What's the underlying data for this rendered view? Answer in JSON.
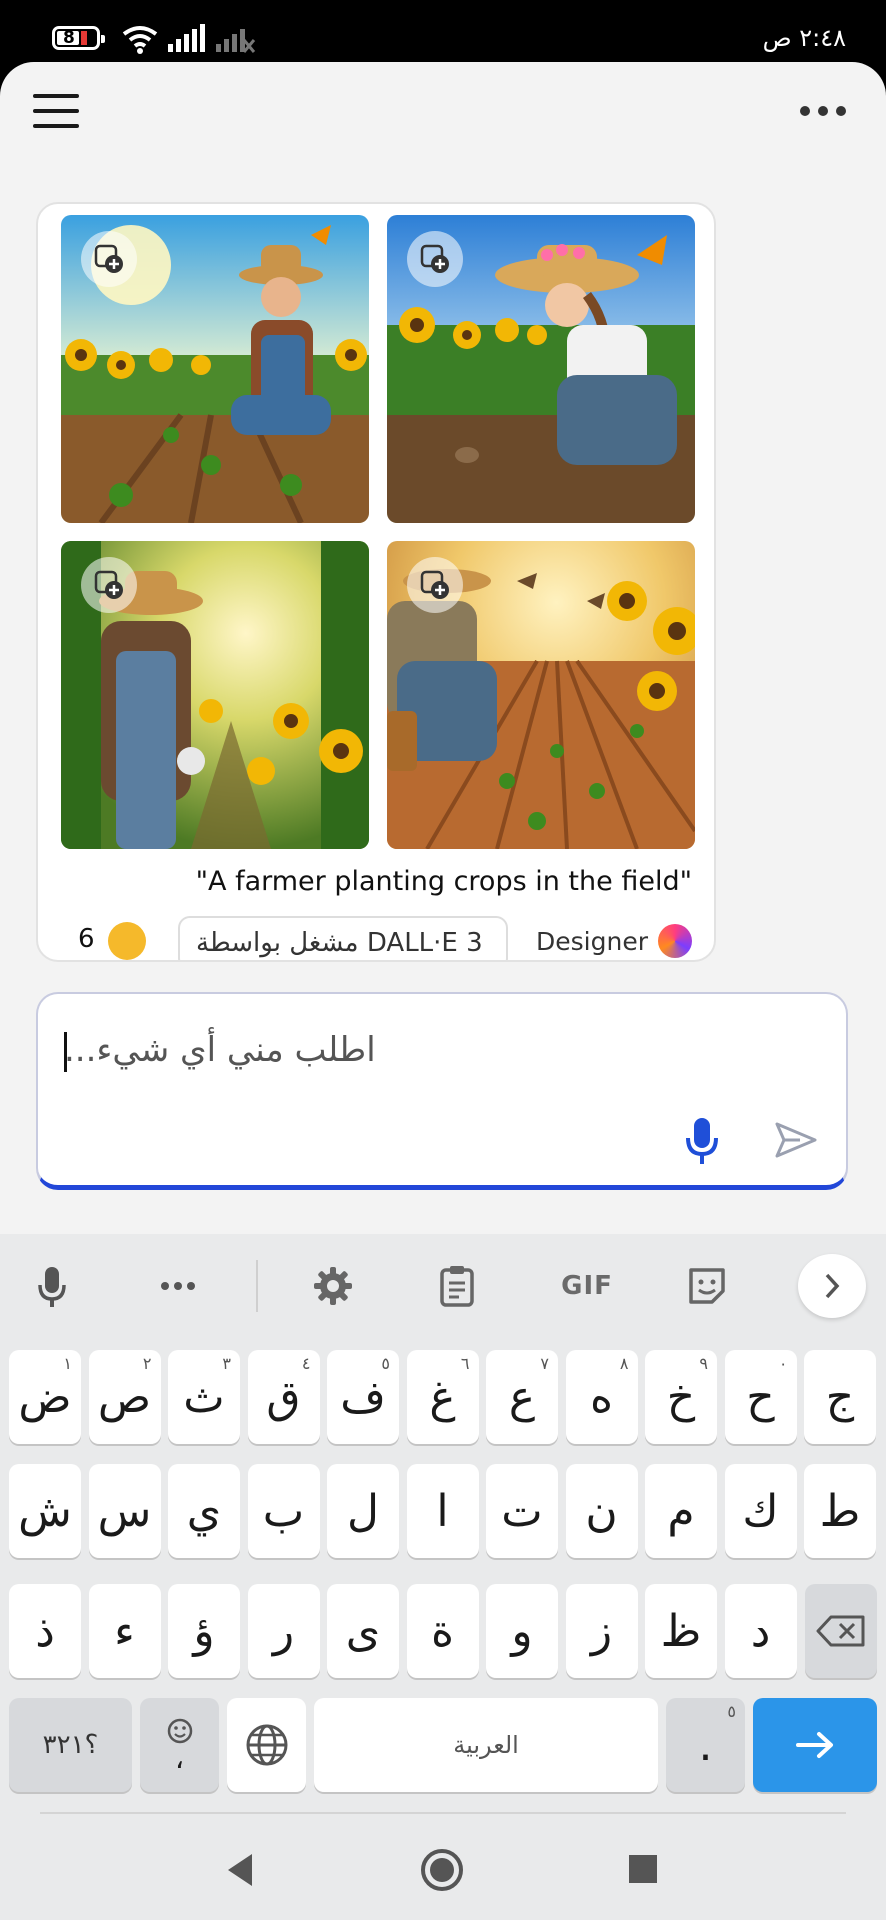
{
  "status_bar": {
    "time": "٢:٤٨ ص",
    "battery": "8"
  },
  "chat": {
    "images": [
      {
        "name": "farmer-man-sunflowers"
      },
      {
        "name": "farmer-woman-sunflowers"
      },
      {
        "name": "farmer-sunlit-path"
      },
      {
        "name": "farmer-rows-birds"
      }
    ],
    "caption": "\"A farmer planting crops in the field\"",
    "count": "6",
    "powered_by": "مشغل بواسطة DALL·E 3",
    "designer_label": "Designer"
  },
  "composer": {
    "placeholder": "اطلب مني أي شيء..."
  },
  "keyboard": {
    "toolbar": {
      "gif_label": "GIF"
    },
    "rows": [
      [
        {
          "label": "ض",
          "hint": "١"
        },
        {
          "label": "ص",
          "hint": "٢"
        },
        {
          "label": "ث",
          "hint": "٣"
        },
        {
          "label": "ق",
          "hint": "٤"
        },
        {
          "label": "ف",
          "hint": "٥"
        },
        {
          "label": "غ",
          "hint": "٦"
        },
        {
          "label": "ع",
          "hint": "٧"
        },
        {
          "label": "ه",
          "hint": "٨"
        },
        {
          "label": "خ",
          "hint": "٩"
        },
        {
          "label": "ح",
          "hint": "٠"
        },
        {
          "label": "ج",
          "hint": ""
        }
      ],
      [
        {
          "label": "ش"
        },
        {
          "label": "س"
        },
        {
          "label": "ي"
        },
        {
          "label": "ب"
        },
        {
          "label": "ل"
        },
        {
          "label": "ا"
        },
        {
          "label": "ت"
        },
        {
          "label": "ن"
        },
        {
          "label": "م"
        },
        {
          "label": "ك"
        },
        {
          "label": "ط"
        }
      ],
      [
        {
          "label": "ذ"
        },
        {
          "label": "ء"
        },
        {
          "label": "ؤ"
        },
        {
          "label": "ر"
        },
        {
          "label": "ى"
        },
        {
          "label": "ة"
        },
        {
          "label": "و"
        },
        {
          "label": "ز"
        },
        {
          "label": "ظ"
        },
        {
          "label": "د"
        }
      ]
    ],
    "bottom_row": {
      "symbols_label": "؟٣٢١",
      "comma_label": "،",
      "space_label": "العربية",
      "period_label": ".",
      "period_hint": "٥"
    }
  }
}
